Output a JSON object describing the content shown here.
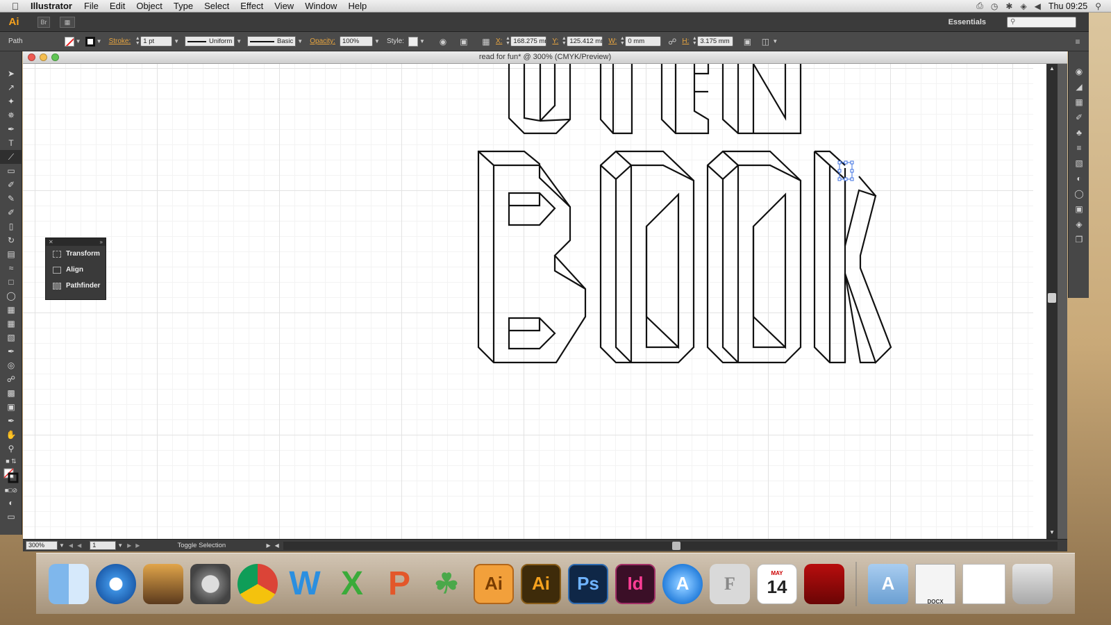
{
  "menubar": {
    "app_name": "Illustrator",
    "menus": [
      "File",
      "Edit",
      "Object",
      "Type",
      "Select",
      "Effect",
      "View",
      "Window",
      "Help"
    ],
    "clock": "Thu 09:25"
  },
  "appbar": {
    "logo": "Ai",
    "workspace": "Essentials"
  },
  "controlbar": {
    "selection_type": "Path",
    "stroke_label": "Stroke:",
    "stroke_weight": "1 pt",
    "profile": "Uniform",
    "brush": "Basic",
    "opacity_label": "Opacity:",
    "opacity": "100%",
    "style_label": "Style:",
    "x_label": "X:",
    "x_value": "168.275 mm",
    "y_label": "Y:",
    "y_value": "125.412 mm",
    "w_label": "W:",
    "w_value": "0 mm",
    "h_label": "H:",
    "h_value": "3.175 mm"
  },
  "document": {
    "title": "read for fun* @ 300% (CMYK/Preview)"
  },
  "float_panel": {
    "items": [
      "Transform",
      "Align",
      "Pathfinder"
    ]
  },
  "statusbar": {
    "zoom": "300%",
    "page": "1",
    "status": "Toggle Selection"
  },
  "dock": {
    "calendar_month": "MAY",
    "calendar_day": "14",
    "docx_label": "DOCX"
  },
  "colors": {
    "accent_orange": "#e9a640",
    "selection_blue": "#3b6fe0"
  }
}
